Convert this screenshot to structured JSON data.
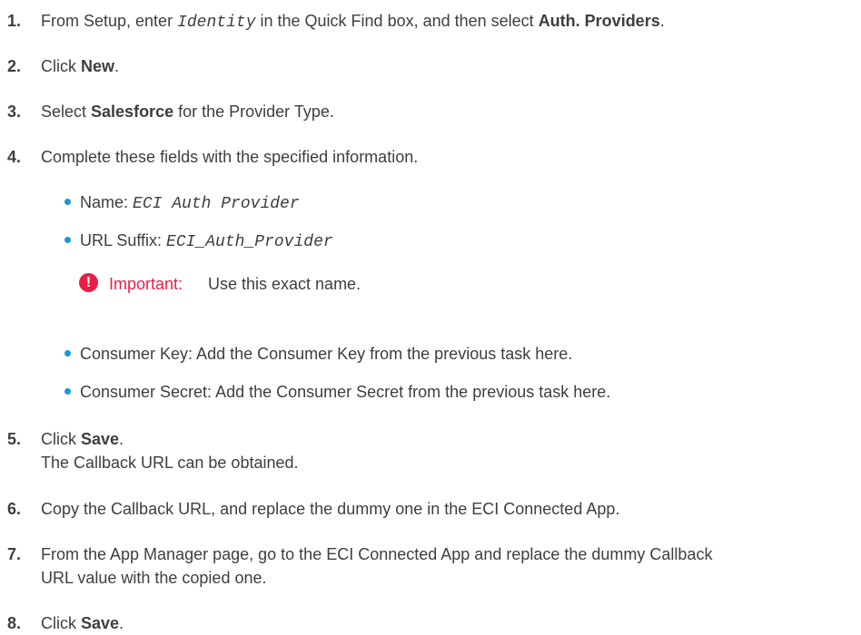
{
  "steps": [
    {
      "number": "1.",
      "prefix": "From Setup, enter ",
      "code": "Identity",
      "middle": " in the Quick Find box, and then select ",
      "bold": "Auth. Providers",
      "suffix": "."
    },
    {
      "number": "2.",
      "prefix": "Click ",
      "bold": "New",
      "suffix": "."
    },
    {
      "number": "3.",
      "prefix": "Select ",
      "bold": "Salesforce",
      "suffix": " for the Provider Type."
    },
    {
      "number": "4.",
      "text": "Complete these fields with the specified information."
    },
    {
      "number": "5.",
      "prefix": "Click ",
      "bold": "Save",
      "suffix": ".",
      "note": "The Callback URL can be obtained."
    },
    {
      "number": "6.",
      "text": "Copy the Callback URL, and replace the dummy one in the ECI Connected App."
    },
    {
      "number": "7.",
      "line1": "From the App Manager page, go to the ECI Connected App and replace the dummy Callback",
      "line2": "URL value with the copied one."
    },
    {
      "number": "8.",
      "prefix": "Click ",
      "bold": "Save",
      "suffix": "."
    }
  ],
  "fields": [
    {
      "label": "Name: ",
      "value": "ECI Auth Provider"
    },
    {
      "label": "URL Suffix: ",
      "value": "ECI_Auth_Provider"
    },
    {
      "text": "Consumer Key: Add the Consumer Key from the previous task here."
    },
    {
      "text": "Consumer Secret: Add the Consumer Secret from the previous task here."
    }
  ],
  "important": {
    "icon": "exclamation-icon",
    "symbol": "!",
    "label": "Important:",
    "text": "Use this exact name.",
    "color": "#e81e46"
  },
  "colors": {
    "text": "#3e3e3c",
    "bullet": "#1b96d4",
    "important": "#e81e46"
  }
}
